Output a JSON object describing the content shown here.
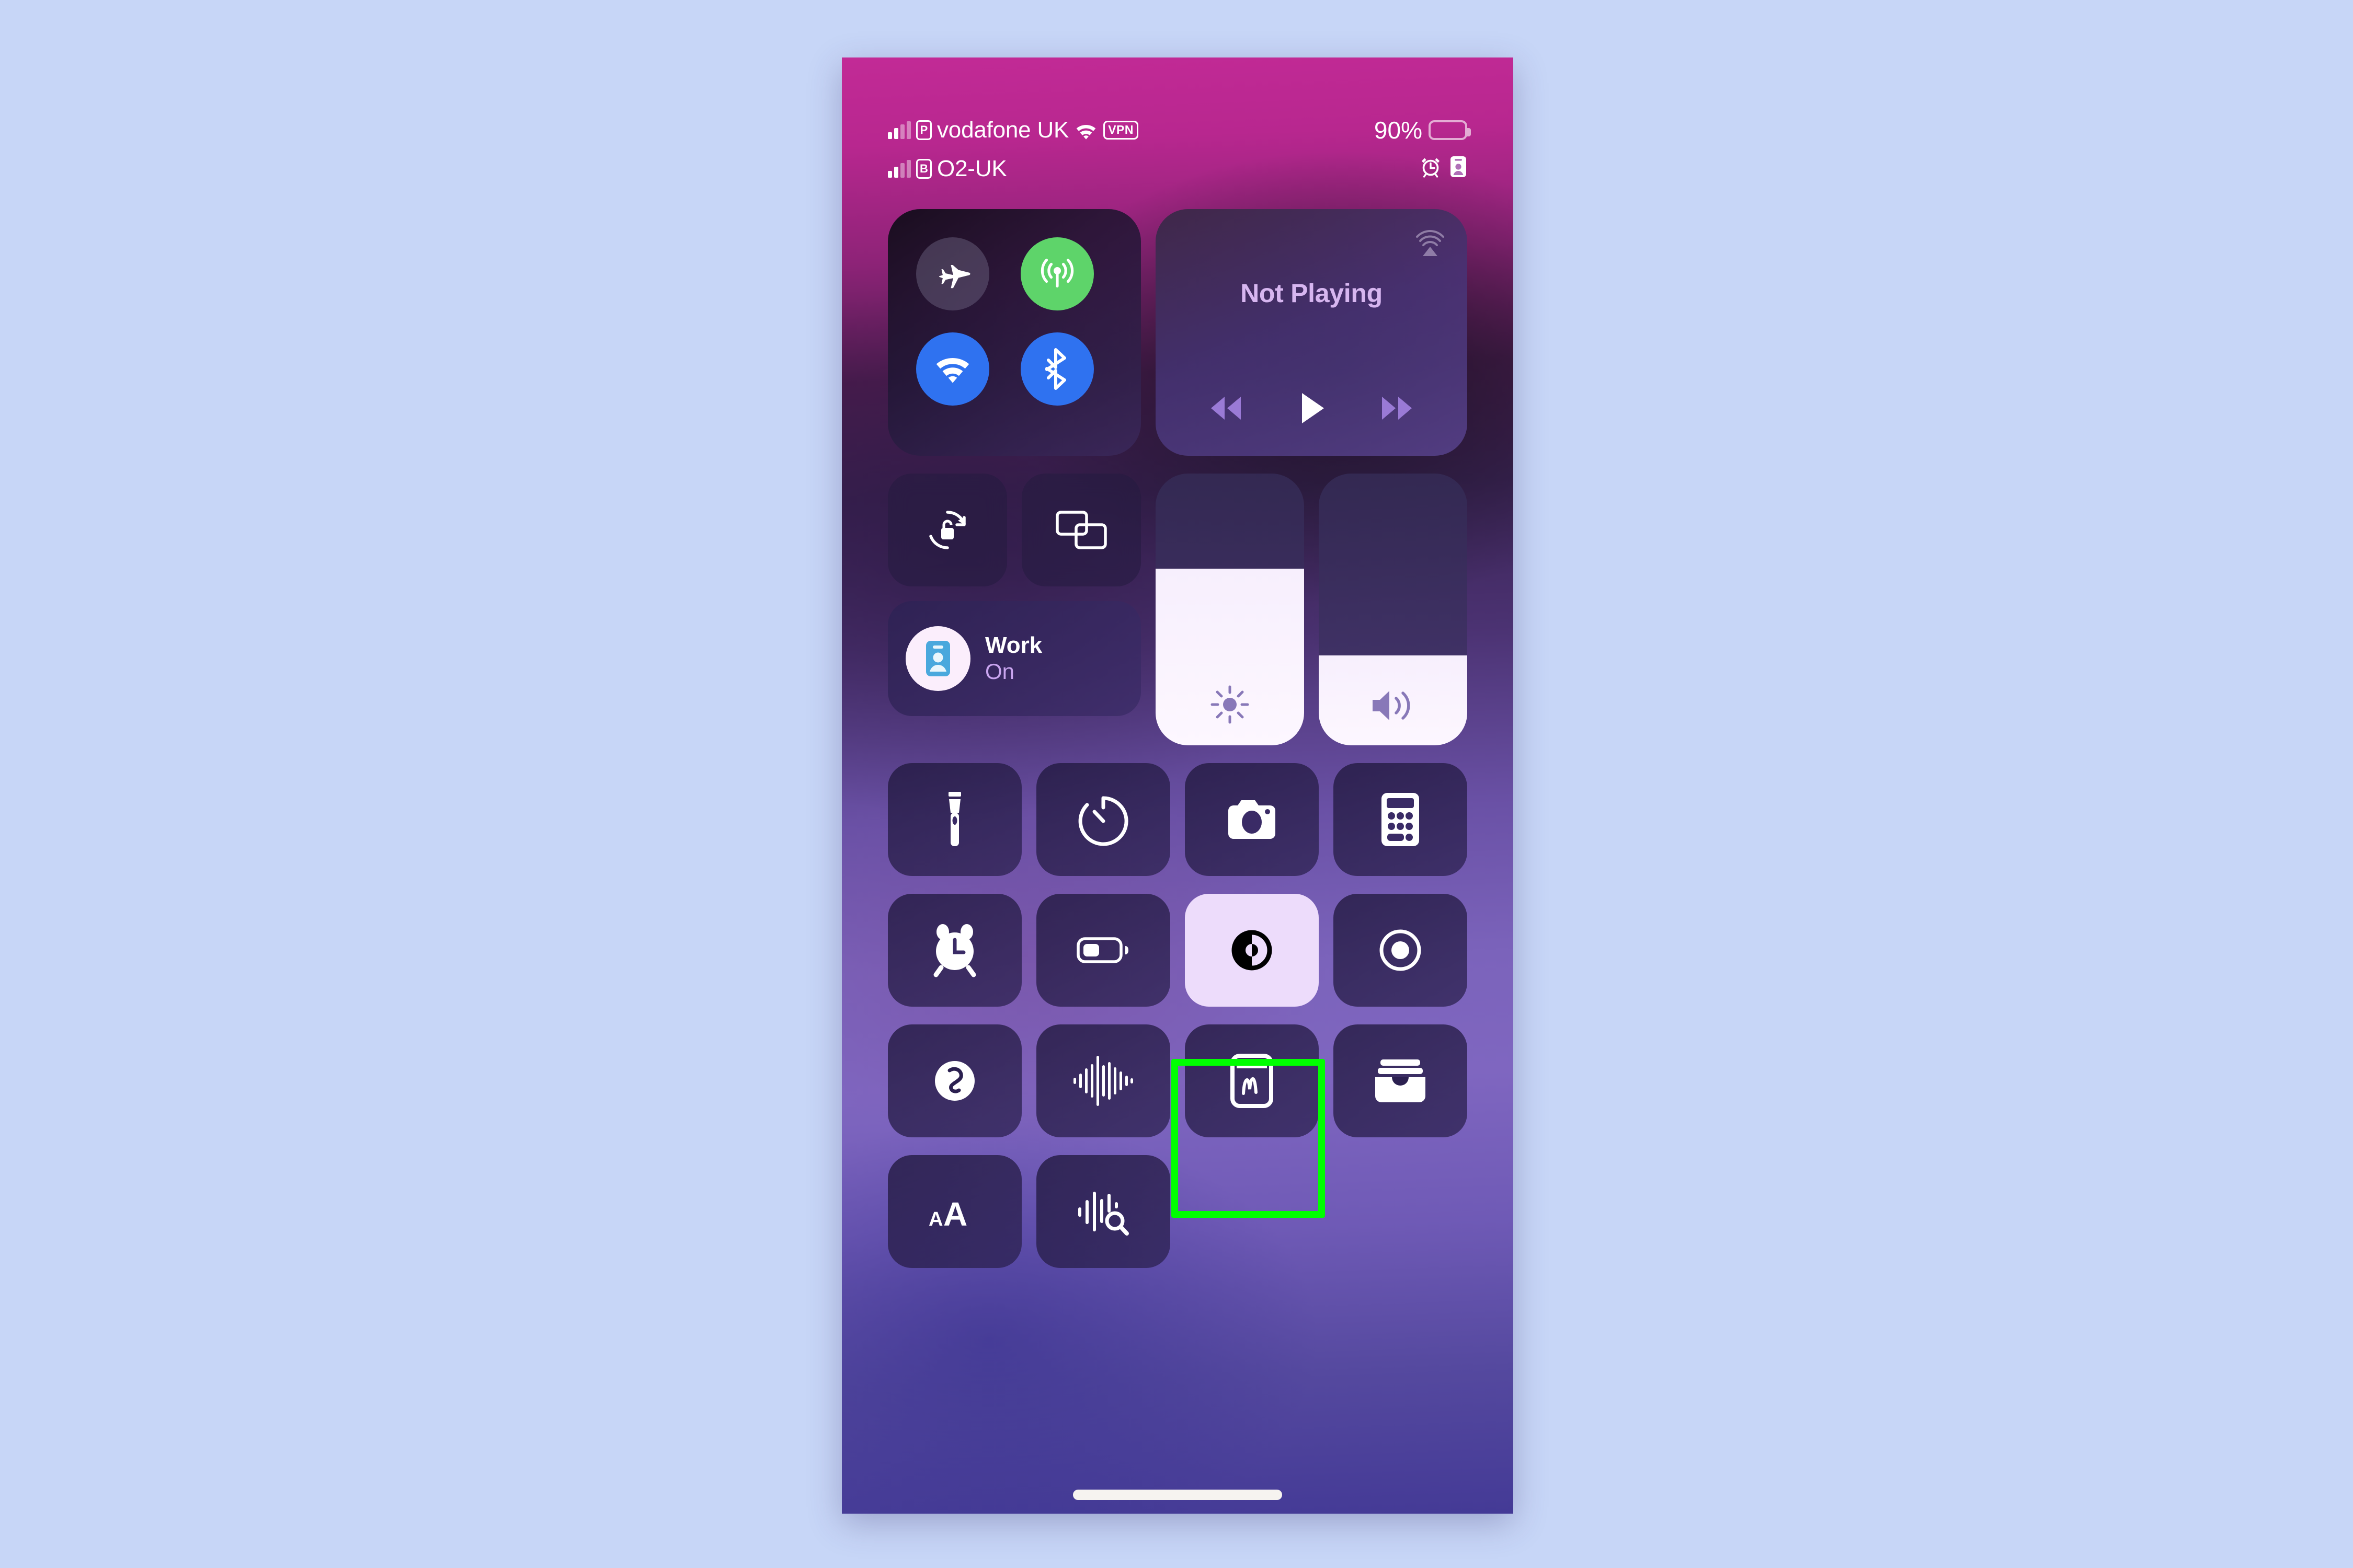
{
  "page": {
    "background_color": "#c7d6f7",
    "highlight_color": "#00ff00"
  },
  "status_bar": {
    "line1": {
      "sim_label": "P",
      "carrier": "vodafone UK",
      "wifi_icon": "wifi-icon",
      "vpn_badge": "VPN"
    },
    "line2": {
      "sim_label": "B",
      "carrier": "O2-UK"
    },
    "battery_percent": "90%",
    "battery_level": 90,
    "alarm_icon": "alarm-clock-icon",
    "focus_icon": "work-focus-badge-icon"
  },
  "connectivity": {
    "airplane": {
      "label": "Airplane Mode",
      "state": "off",
      "color": "#78708c",
      "icon": "airplane-icon"
    },
    "cellular": {
      "label": "Cellular Data",
      "state": "on",
      "color": "#5ed46a",
      "icon": "cellular-antenna-icon"
    },
    "wifi": {
      "label": "Wi-Fi",
      "state": "on",
      "color": "#2f72f0",
      "icon": "wifi-icon"
    },
    "bluetooth": {
      "label": "Bluetooth",
      "state": "on",
      "color": "#2f72f0",
      "icon": "bluetooth-icon"
    }
  },
  "media": {
    "now_playing": "Not Playing",
    "airplay_icon": "airplay-icon",
    "controls": [
      {
        "name": "rewind-button",
        "icon": "rewind-icon"
      },
      {
        "name": "play-button",
        "icon": "play-icon"
      },
      {
        "name": "fast-forward-button",
        "icon": "fast-forward-icon"
      }
    ]
  },
  "quick_toggles": {
    "rotation_lock": {
      "label": "Rotation Lock",
      "icon": "rotation-lock-icon",
      "state": "off"
    },
    "screen_mirroring": {
      "label": "Screen Mirroring",
      "icon": "screen-mirroring-icon",
      "state": "off"
    }
  },
  "focus": {
    "name": "Work",
    "state": "On",
    "icon": "work-focus-badge-icon",
    "icon_color": "#4aa8dd"
  },
  "sliders": {
    "brightness": {
      "label": "Brightness",
      "value": 65,
      "icon": "brightness-sun-icon"
    },
    "volume": {
      "label": "Volume",
      "value": 33,
      "icon": "volume-speaker-icon"
    }
  },
  "tiles": {
    "row1": [
      {
        "name": "flashlight-tile",
        "label": "Flashlight",
        "icon": "flashlight-icon",
        "active": false
      },
      {
        "name": "timer-tile",
        "label": "Timer",
        "icon": "timer-icon",
        "active": false
      },
      {
        "name": "camera-tile",
        "label": "Camera",
        "icon": "camera-icon",
        "active": false
      },
      {
        "name": "calculator-tile",
        "label": "Calculator",
        "icon": "calculator-icon",
        "active": false
      }
    ],
    "row2": [
      {
        "name": "alarm-tile",
        "label": "Alarm",
        "icon": "alarm-clock-icon",
        "active": false
      },
      {
        "name": "low-power-mode-tile",
        "label": "Low Power Mode",
        "icon": "battery-low-icon",
        "active": false
      },
      {
        "name": "dark-mode-tile",
        "label": "Dark Mode",
        "icon": "dark-mode-contrast-icon",
        "active": true,
        "highlighted": true
      },
      {
        "name": "screen-recording-tile",
        "label": "Screen Recording",
        "icon": "screen-record-icon",
        "active": false
      }
    ],
    "row3": [
      {
        "name": "shazam-tile",
        "label": "Music Recognition",
        "icon": "shazam-icon",
        "active": false
      },
      {
        "name": "voice-memos-tile",
        "label": "Voice Memos",
        "icon": "waveform-icon",
        "active": false
      },
      {
        "name": "quick-note-tile",
        "label": "Quick Note",
        "icon": "quick-note-icon",
        "active": false
      },
      {
        "name": "wallet-tile",
        "label": "Wallet",
        "icon": "wallet-icon",
        "active": false
      }
    ],
    "row4": [
      {
        "name": "text-size-tile",
        "label": "Text Size",
        "icon": "text-size-icon",
        "active": false
      },
      {
        "name": "sound-recognition-tile",
        "label": "Sound Recognition",
        "icon": "sound-recognition-icon",
        "active": false
      }
    ]
  }
}
